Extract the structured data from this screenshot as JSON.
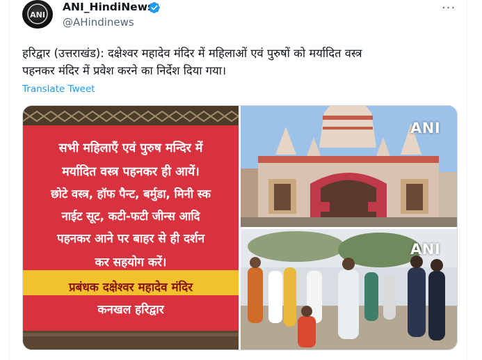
{
  "tweet": {
    "display_name": "ANI_HindiNews",
    "handle": "@AHindinews",
    "avatar_text": "ANI",
    "more_label": "···",
    "text_lines": [
      "हरिद्वार (उत्तराखंड): दक्षेश्वर महादेव मंदिर में महिलाओं एवं पुरुषों को मर्यादित वस्त्र",
      "पहनकर मंदिर में प्रवेश करने का निर्देश दिया गया।"
    ],
    "translate_label": "Translate Tweet"
  },
  "media": {
    "banner_lines": [
      "सभी महिलाएँ एवं पुरुष मन्दिर में",
      "मर्यादित वस्त्र पहनकर ही आयें।",
      "छोटे वस्त्र, हॉफ पैन्ट, बर्मुडा, मिनी स्क",
      "नाईट सूट, कटी-फटी जीन्स आदि",
      "पहनकर आने पर बाहर से ही दर्शन",
      "कर सहयोग करें।",
      "प्रबंधक दक्षेश्वर महादेव मंदिर",
      "कनखल हरिद्वार"
    ],
    "watermark_top": "ANI",
    "watermark_bottom": "ANI"
  },
  "colors": {
    "accent": "#1d9bf0",
    "text": "#0f1419",
    "muted": "#536471",
    "banner_red": "#d9323f",
    "banner_yellow": "#f2c12e"
  }
}
